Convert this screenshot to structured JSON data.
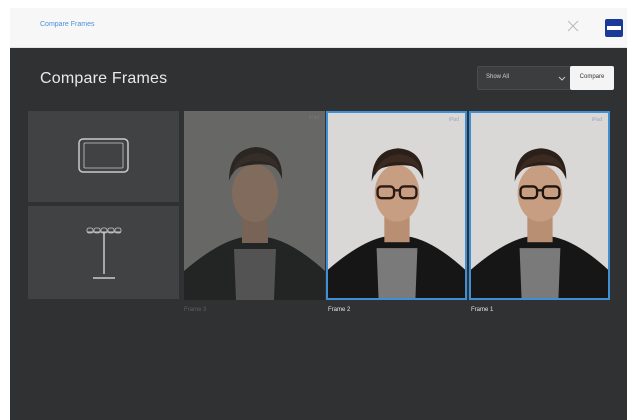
{
  "titlebar": {
    "title": "Compare Frames"
  },
  "header": {
    "title": "Compare Frames",
    "filter_value": "Show All",
    "compare_label": "Compare"
  },
  "frames": [
    {
      "label": "Frame 3",
      "tag": "iPad",
      "selected": false,
      "glasses": false
    },
    {
      "label": "Frame 2",
      "tag": "iPad",
      "selected": true,
      "glasses": true
    },
    {
      "label": "Frame 1",
      "tag": "iPad",
      "selected": true,
      "glasses": true
    }
  ],
  "colors": {
    "accent": "#3f8fd6",
    "background": "#303132",
    "brand": "#1a3a9a"
  }
}
